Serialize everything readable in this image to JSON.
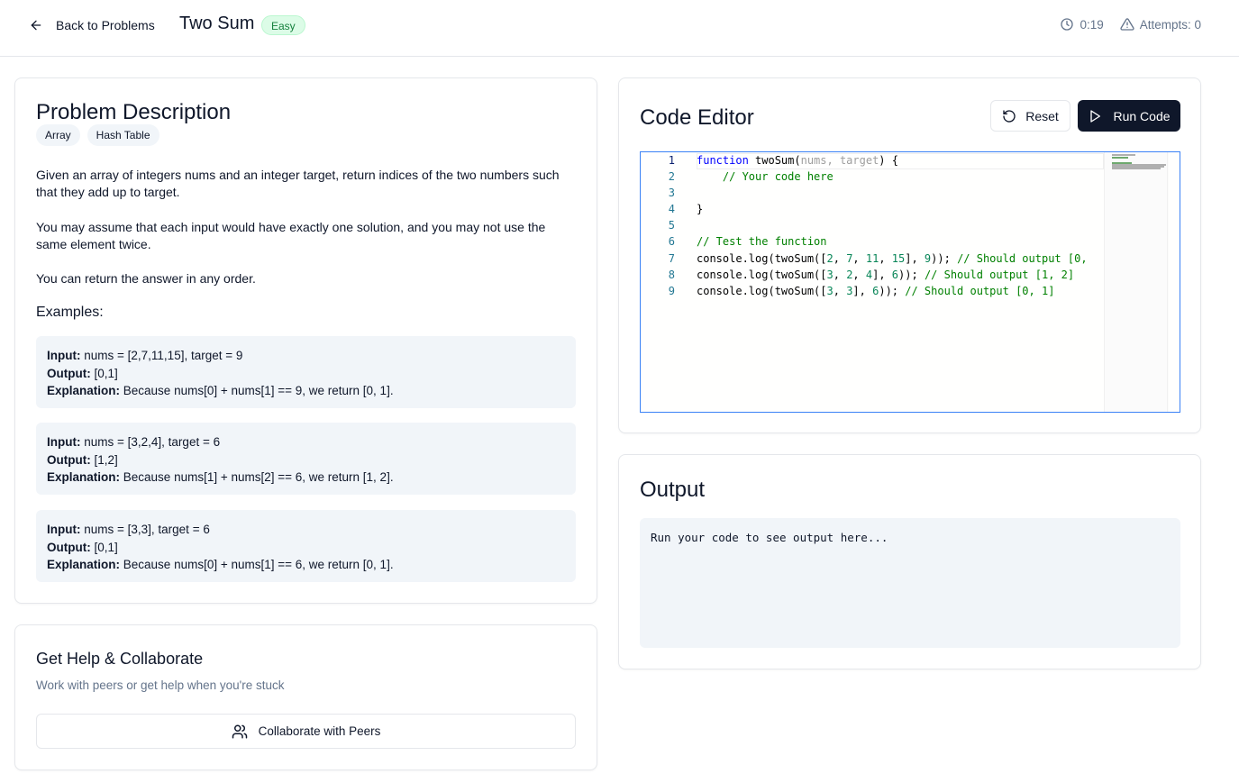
{
  "header": {
    "back_label": "Back to Problems",
    "title": "Two Sum",
    "difficulty": "Easy",
    "timer": "0:19",
    "attempts": "Attempts: 0"
  },
  "problem": {
    "heading": "Problem Description",
    "tags": [
      "Array",
      "Hash Table"
    ],
    "paragraphs": [
      "Given an array of integers nums and an integer target, return indices of the two numbers such that they add up to target.",
      "You may assume that each input would have exactly one solution, and you may not use the same element twice.",
      "You can return the answer in any order."
    ],
    "examples_heading": "Examples:",
    "labels": {
      "input": "Input:",
      "output": "Output:",
      "explanation": "Explanation:"
    },
    "examples": [
      {
        "input": "nums = [2,7,11,15], target = 9",
        "output": "[0,1]",
        "explanation": "Because nums[0] + nums[1] == 9, we return [0, 1]."
      },
      {
        "input": "nums = [3,2,4], target = 6",
        "output": "[1,2]",
        "explanation": "Because nums[1] + nums[2] == 6, we return [1, 2]."
      },
      {
        "input": "nums = [3,3], target = 6",
        "output": "[0,1]",
        "explanation": "Because nums[0] + nums[1] == 6, we return [0, 1]."
      }
    ]
  },
  "help": {
    "title": "Get Help & Collaborate",
    "subtitle": "Work with peers or get help when you're stuck",
    "button": "Collaborate with Peers"
  },
  "editor": {
    "title": "Code Editor",
    "reset_label": "Reset",
    "run_label": "Run Code",
    "line_numbers": [
      "1",
      "2",
      "3",
      "4",
      "5",
      "6",
      "7",
      "8",
      "9"
    ],
    "code": {
      "l1_kw": "function",
      "l1_name": " twoSum(",
      "l1_params": "nums, target",
      "l1_end": ") {",
      "l2": "    // Your code here",
      "l4": "}",
      "l6": "// Test the function",
      "l7_a": "console.log(twoSum([",
      "l7_n1": "2",
      "l7_n2": "7",
      "l7_n3": "11",
      "l7_n4": "15",
      "l7_n5": "9",
      "l7_cm": "// Should output [0,",
      "l8_a": "console.log(twoSum([",
      "l8_n1": "3",
      "l8_n2": "2",
      "l8_n3": "4",
      "l8_n4": "6",
      "l8_cm": "// Should output [1, 2]",
      "l9_a": "console.log(twoSum([",
      "l9_n1": "3",
      "l9_n2": "3",
      "l9_n3": "6",
      "l9_cm": "// Should output [0, 1]",
      "sep": ", ",
      "close_arr": "], ",
      "close_call": ")); "
    }
  },
  "output": {
    "title": "Output",
    "placeholder": "Run your code to see output here..."
  },
  "colors": {
    "primary": "#0f172a",
    "easy_bg": "#dcfce7",
    "easy_text": "#15803d",
    "muted": "#64748b",
    "panel_bg": "#f1f5f9"
  }
}
